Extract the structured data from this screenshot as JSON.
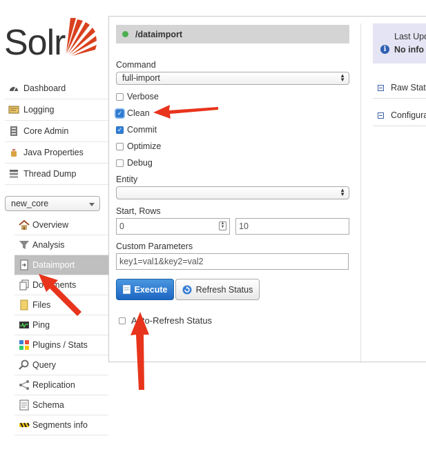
{
  "logo": {
    "text": "Solr"
  },
  "nav": {
    "items": [
      {
        "label": "Dashboard",
        "icon": "dashboard-icon"
      },
      {
        "label": "Logging",
        "icon": "logging-icon"
      },
      {
        "label": "Core Admin",
        "icon": "core-admin-icon"
      },
      {
        "label": "Java Properties",
        "icon": "java-icon"
      },
      {
        "label": "Thread Dump",
        "icon": "thread-dump-icon"
      }
    ]
  },
  "core_selector": {
    "value": "new_core"
  },
  "core_nav": {
    "items": [
      {
        "label": "Overview",
        "icon": "home-icon"
      },
      {
        "label": "Analysis",
        "icon": "funnel-icon"
      },
      {
        "label": "Dataimport",
        "icon": "dataimport-icon",
        "active": true
      },
      {
        "label": "Documents",
        "icon": "documents-icon"
      },
      {
        "label": "Files",
        "icon": "folder-icon"
      },
      {
        "label": "Ping",
        "icon": "ping-icon"
      },
      {
        "label": "Plugins / Stats",
        "icon": "plugins-icon"
      },
      {
        "label": "Query",
        "icon": "magnifier-icon"
      },
      {
        "label": "Replication",
        "icon": "replication-icon"
      },
      {
        "label": "Schema",
        "icon": "schema-icon"
      },
      {
        "label": "Segments info",
        "icon": "segments-icon"
      }
    ]
  },
  "panel": {
    "handler": "/dataimport",
    "status_color": "#4caf50",
    "command_label": "Command",
    "command_value": "full-import",
    "checkboxes": [
      {
        "label": "Verbose",
        "checked": false
      },
      {
        "label": "Clean",
        "checked": true
      },
      {
        "label": "Commit",
        "checked": true
      },
      {
        "label": "Optimize",
        "checked": false
      },
      {
        "label": "Debug",
        "checked": false
      }
    ],
    "entity_label": "Entity",
    "entity_value": "",
    "start_rows_label": "Start, Rows",
    "start_value": "0",
    "rows_value": "10",
    "custom_params_label": "Custom Parameters",
    "custom_params_value": "key1=val1&key2=val2",
    "execute_label": "Execute",
    "refresh_label": "Refresh Status",
    "auto_refresh_label": "Auto-Refresh Status",
    "auto_refresh_checked": false
  },
  "status_panel": {
    "last_update_label": "Last Upd",
    "no_info_label": "No info",
    "raw_status_label": "Raw Statu",
    "configuration_label": "Configura"
  },
  "colors": {
    "accent": "#1d66c2",
    "arrow": "#e8341c",
    "active_nav": "#bfbfbf"
  }
}
